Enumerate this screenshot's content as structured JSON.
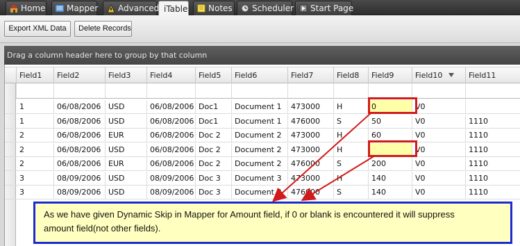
{
  "tabs": [
    {
      "label": "Home",
      "icon": "home-icon",
      "active": false
    },
    {
      "label": "Mapper",
      "icon": "mapper-icon",
      "active": false
    },
    {
      "label": "Advanced",
      "icon": "advanced-icon",
      "active": false
    },
    {
      "label": "iTable",
      "icon": "",
      "active": true
    },
    {
      "label": "Notes",
      "icon": "note-icon",
      "active": false
    },
    {
      "label": "Scheduler",
      "icon": "scheduler-icon",
      "active": false
    },
    {
      "label": "Start Page",
      "icon": "start-page-icon",
      "active": false
    }
  ],
  "toolbar": {
    "export_label": "Export XML Data",
    "delete_label": "Delete Records"
  },
  "groupby_text": "Drag a column header here to group by that column",
  "columns": [
    "Field1",
    "Field2",
    "Field3",
    "Field4",
    "Field5",
    "Field6",
    "Field7",
    "Field8",
    "Field9",
    "Field10",
    "Field11"
  ],
  "sorted_column": "Field10",
  "rows": [
    [
      "1",
      "06/08/2006",
      "USD",
      "06/08/2006",
      "Doc1",
      "Document 1",
      "473000",
      "H",
      "0",
      "V0",
      ""
    ],
    [
      "1",
      "06/08/2006",
      "USD",
      "06/08/2006",
      "Doc1",
      "Document 1",
      "476000",
      "S",
      "50",
      "V0",
      "1110"
    ],
    [
      "2",
      "06/08/2006",
      "EUR",
      "06/08/2006",
      "Doc 2",
      "Document 2",
      "473000",
      "H",
      "60",
      "V0",
      "1110"
    ],
    [
      "2",
      "06/08/2006",
      "USD",
      "06/08/2006",
      "Doc 2",
      "Document 2",
      "473000",
      "H",
      "",
      "V0",
      "1110"
    ],
    [
      "2",
      "06/08/2006",
      "EUR",
      "06/08/2006",
      "Doc 2",
      "Document 2",
      "476000",
      "S",
      "200",
      "V0",
      "1110"
    ],
    [
      "3",
      "08/09/2006",
      "USD",
      "08/09/2006",
      "Doc 3",
      "Document 3",
      "473000",
      "H",
      "140",
      "V0",
      "1110"
    ],
    [
      "3",
      "08/09/2006",
      "USD",
      "08/09/2006",
      "Doc 3",
      "Document 3",
      "476000",
      "S",
      "140",
      "V0",
      "1110"
    ]
  ],
  "highlighted_cells": [
    [
      0,
      8
    ],
    [
      3,
      8
    ]
  ],
  "callout": {
    "line1": "As we have given Dynamic Skip in Mapper for Amount field, if 0 or blank is encountered it will suppress",
    "line2": "amount field(not other fields)."
  },
  "colors": {
    "highlight_fill": "#ffffa8",
    "highlight_border": "#d11a1a",
    "callout_border": "#1c2bd1",
    "callout_fill": "#ffffbf"
  }
}
